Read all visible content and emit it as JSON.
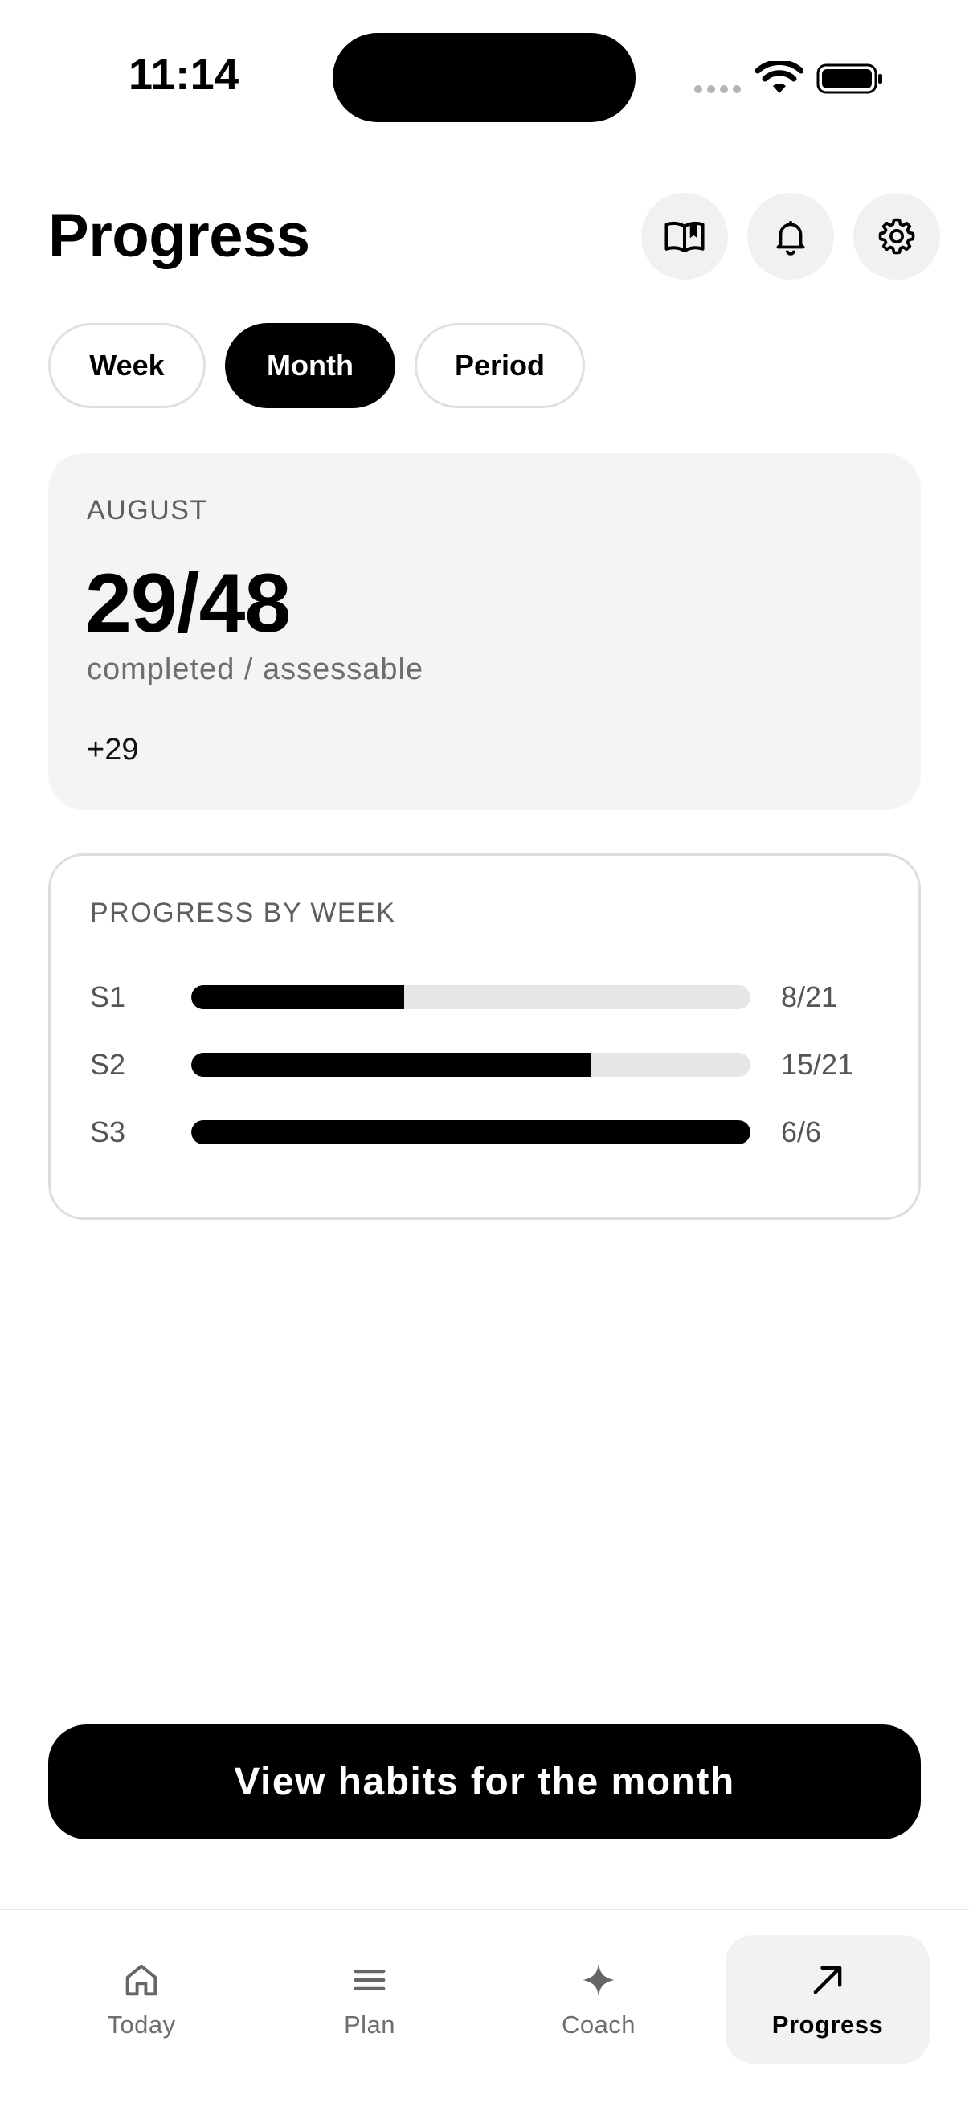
{
  "status_bar": {
    "time": "11:14"
  },
  "header": {
    "title": "Progress",
    "icons": [
      "book-icon",
      "bell-icon",
      "gear-icon"
    ]
  },
  "tabs": [
    {
      "label": "Week",
      "active": false
    },
    {
      "label": "Month",
      "active": true
    },
    {
      "label": "Period",
      "active": false
    }
  ],
  "summary": {
    "month": "AUGUST",
    "ratio": "29/48",
    "caption": "completed / assessable",
    "delta": "+29"
  },
  "weekly": {
    "title": "PROGRESS BY WEEK",
    "rows": [
      {
        "label": "S1",
        "value": "8/21",
        "fraction": 0.381
      },
      {
        "label": "S2",
        "value": "15/21",
        "fraction": 0.714
      },
      {
        "label": "S3",
        "value": "6/6",
        "fraction": 1.0
      }
    ]
  },
  "cta": {
    "label": "View habits for the month"
  },
  "nav": [
    {
      "label": "Today",
      "icon": "home-icon",
      "active": false
    },
    {
      "label": "Plan",
      "icon": "menu-icon",
      "active": false
    },
    {
      "label": "Coach",
      "icon": "sparkle-icon",
      "active": false
    },
    {
      "label": "Progress",
      "icon": "arrow-up-right-icon",
      "active": true
    }
  ],
  "colors": {
    "accent": "#000000",
    "card_bg": "#f4f4f4",
    "track": "#e6e6e6",
    "muted_text": "#6e6e6e"
  }
}
